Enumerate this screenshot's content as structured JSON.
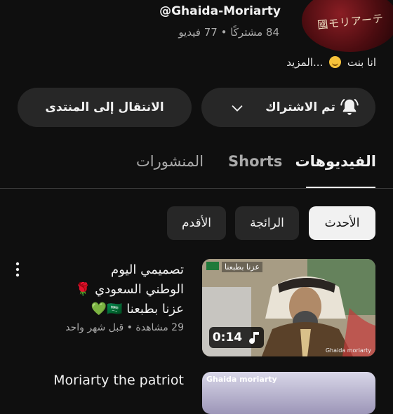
{
  "channel": {
    "handle": "@Ghaida-Moriarty",
    "subscribers": "84 مشتركًا",
    "separator": "•",
    "videos": "77 فيديو",
    "description_prefix": "انا بنت",
    "description_more": "...المزيد",
    "avatar_text": "國モリアーテ"
  },
  "actions": {
    "subscribed_label": "تم الاشتراك",
    "community_label": "الانتقال إلى المنتدى"
  },
  "tabs": {
    "videos": "الفيديوهات",
    "shorts": "Shorts",
    "posts": "المنشورات"
  },
  "chips": {
    "latest": "الأحدث",
    "popular": "الرائجة",
    "oldest": "الأقدم"
  },
  "videos": [
    {
      "title_line1": "تصميمي اليوم",
      "title_line2": "الوطني السعودي 🌹",
      "title_line3": "عزنا بطبعنا 🇸🇦💚",
      "stats": "29 مشاهدة • قبل شهر واحد",
      "duration": "0:14",
      "thumb_caption": "عزنا بطبعنا",
      "thumb_watermark": "Ghaida moriarty"
    },
    {
      "title": "Moriarty the patriot",
      "thumb_caption": "Ghaida moriarty"
    }
  ],
  "colors": {
    "background": "#0f0f0f",
    "chip": "#272727",
    "text": "#f1f1f1",
    "secondary": "#aaaaaa"
  }
}
